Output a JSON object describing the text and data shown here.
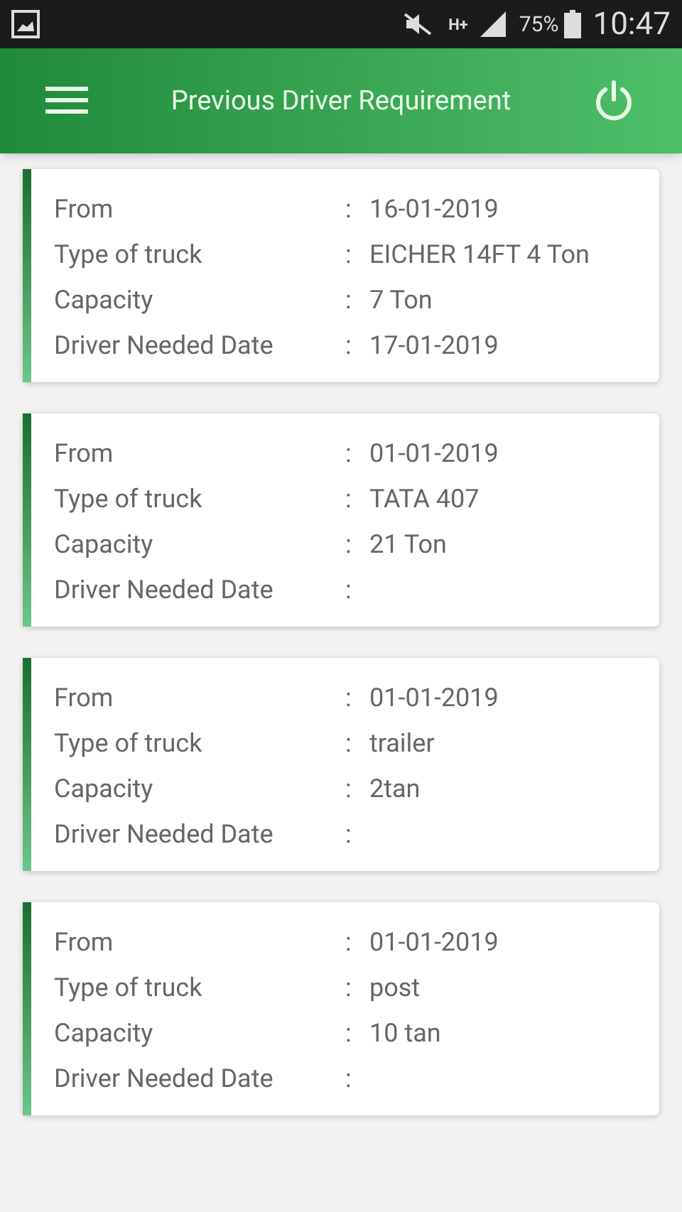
{
  "status_bar": {
    "network": "H+",
    "battery": "75%",
    "time": "10:47"
  },
  "app_bar": {
    "title": "Previous Driver Requirement"
  },
  "cards": [
    {
      "rows": [
        {
          "label": "From",
          "separator": ":",
          "value": "16-01-2019"
        },
        {
          "label": "Type of truck",
          "separator": ":",
          "value": "EICHER 14FT 4 Ton"
        },
        {
          "label": "Capacity",
          "separator": ":",
          "value": "7 Ton"
        },
        {
          "label": "Driver Needed Date",
          "separator": ":",
          "value": "17-01-2019"
        }
      ]
    },
    {
      "rows": [
        {
          "label": "From",
          "separator": ":",
          "value": "01-01-2019"
        },
        {
          "label": "Type of truck",
          "separator": ":",
          "value": "TATA 407"
        },
        {
          "label": "Capacity",
          "separator": ":",
          "value": "21 Ton"
        },
        {
          "label": "Driver Needed Date",
          "separator": ":"
        }
      ]
    },
    {
      "rows": [
        {
          "label": "From",
          "separator": ":",
          "value": "01-01-2019"
        },
        {
          "label": "Type of truck",
          "separator": ":",
          "value": "trailer"
        },
        {
          "label": "Capacity",
          "separator": ":",
          "value": "2tan"
        },
        {
          "label": "Driver Needed Date",
          "separator": ":"
        }
      ]
    },
    {
      "rows": [
        {
          "label": "From",
          "separator": ":",
          "value": "01-01-2019"
        },
        {
          "label": "Type of truck",
          "separator": ":",
          "value": "post"
        },
        {
          "label": "Capacity",
          "separator": ":",
          "value": "10 tan"
        },
        {
          "label": "Driver Needed Date",
          "separator": ":"
        }
      ]
    }
  ]
}
